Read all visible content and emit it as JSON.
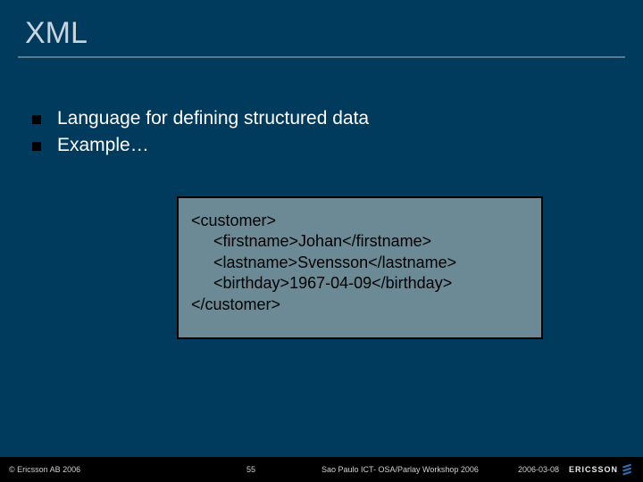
{
  "title": "XML",
  "bullets": [
    "Language for defining structured data",
    "Example…"
  ],
  "code": [
    "<customer>",
    "     <firstname>Johan</firstname>",
    "     <lastname>Svensson</lastname>",
    "     <birthday>1967-04-09</birthday>",
    "</customer>"
  ],
  "footer": {
    "copyright": "© Ericsson AB 2006",
    "page": "55",
    "event": "Sao Paulo ICT- OSA/Parlay Workshop 2006",
    "date": "2006-03-08",
    "brand": "ERICSSON"
  }
}
